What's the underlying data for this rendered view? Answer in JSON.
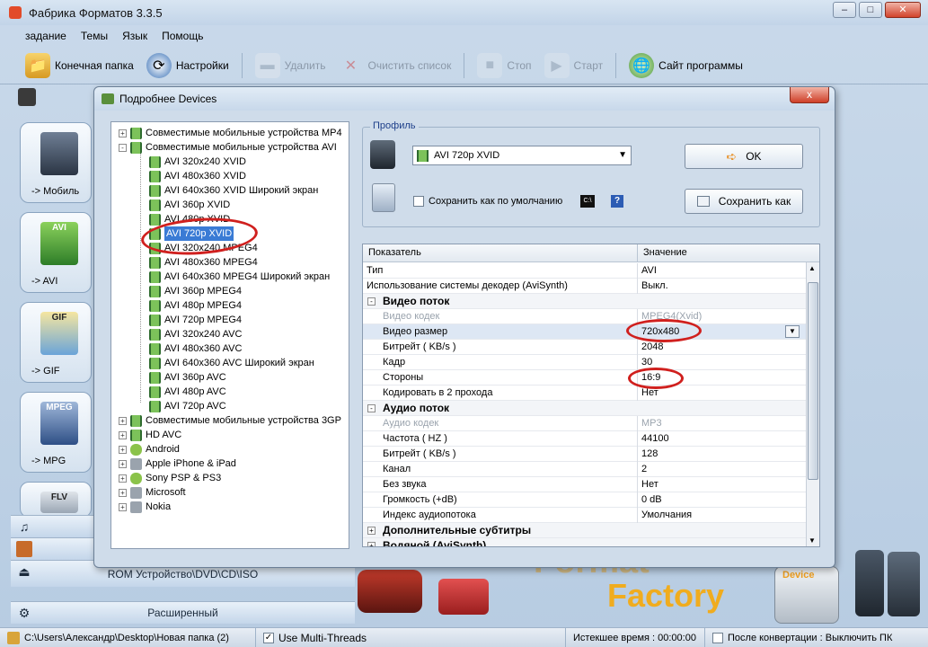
{
  "app": {
    "title": "Фабрика Форматов 3.3.5",
    "menu": [
      "задание",
      "Темы",
      "Язык",
      "Помощь"
    ],
    "toolbar": [
      {
        "label": "Конечная папка",
        "icon": "folder-icon",
        "enabled": true
      },
      {
        "label": "Настройки",
        "icon": "settings-icon",
        "enabled": true
      },
      {
        "label": "Удалить",
        "icon": "delete-icon",
        "enabled": false
      },
      {
        "label": "Очистить список",
        "icon": "clear-list-icon",
        "enabled": false
      },
      {
        "label": "Стоп",
        "icon": "stop-icon",
        "enabled": false
      },
      {
        "label": "Старт",
        "icon": "start-icon",
        "enabled": false
      },
      {
        "label": "Сайт программы",
        "icon": "globe-icon",
        "enabled": true
      }
    ],
    "left_buttons": [
      "-> Мобиль",
      "-> AVI",
      "-> GIF",
      "-> MPG"
    ],
    "left_thumbs": {
      "avi": "AVI",
      "gif": "GIF",
      "mpeg": "MPEG",
      "flv": "FLV"
    },
    "categories": [
      "ROM Устройство\\DVD\\CD\\ISO",
      "Расширенный"
    ],
    "brand": {
      "word1": "Format",
      "word2": "Factory",
      "device": "Device"
    },
    "status": {
      "path": "C:\\Users\\Александр\\Desktop\\Новая папка (2)",
      "multithreads": "Use Multi-Threads",
      "elapsed": "Истекшее время : 00:00:00",
      "after": "После конвертации : Выключить ПК"
    }
  },
  "dialog": {
    "title": "Подробнее Devices",
    "close": "x",
    "tree": [
      {
        "label": "Совместимые мобильные устройства MP4",
        "level": 0,
        "exp": "+",
        "icon": "film"
      },
      {
        "label": "Совместимые мобильные устройства AVI",
        "level": 0,
        "exp": "-",
        "icon": "film"
      },
      {
        "label": "AVI 320x240 XVID",
        "level": 1,
        "icon": "film"
      },
      {
        "label": "AVI 480x360 XVID",
        "level": 1,
        "icon": "film"
      },
      {
        "label": "AVI 640x360 XVID Широкий экран",
        "level": 1,
        "icon": "film"
      },
      {
        "label": "AVI 360p XVID",
        "level": 1,
        "icon": "film"
      },
      {
        "label": "AVI 480p XVID",
        "level": 1,
        "icon": "film"
      },
      {
        "label": "AVI 720p XVID",
        "level": 1,
        "icon": "film",
        "selected": true
      },
      {
        "label": "AVI 320x240 MPEG4",
        "level": 1,
        "icon": "film"
      },
      {
        "label": "AVI 480x360 MPEG4",
        "level": 1,
        "icon": "film"
      },
      {
        "label": "AVI 640x360 MPEG4 Широкий экран",
        "level": 1,
        "icon": "film"
      },
      {
        "label": "AVI 360p MPEG4",
        "level": 1,
        "icon": "film"
      },
      {
        "label": "AVI 480p MPEG4",
        "level": 1,
        "icon": "film"
      },
      {
        "label": "AVI 720p MPEG4",
        "level": 1,
        "icon": "film"
      },
      {
        "label": "AVI 320x240 AVC",
        "level": 1,
        "icon": "film"
      },
      {
        "label": "AVI 480x360 AVC",
        "level": 1,
        "icon": "film"
      },
      {
        "label": "AVI 640x360 AVC Широкий экран",
        "level": 1,
        "icon": "film"
      },
      {
        "label": "AVI 360p AVC",
        "level": 1,
        "icon": "film"
      },
      {
        "label": "AVI 480p AVC",
        "level": 1,
        "icon": "film"
      },
      {
        "label": "AVI 720p AVC",
        "level": 1,
        "icon": "film"
      },
      {
        "label": "Совместимые мобильные устройства 3GP",
        "level": 0,
        "exp": "+",
        "icon": "film"
      },
      {
        "label": "HD AVC",
        "level": 0,
        "exp": "+",
        "icon": "film"
      },
      {
        "label": "Android",
        "level": 0,
        "exp": "+",
        "icon": "green"
      },
      {
        "label": "Apple iPhone & iPad",
        "level": 0,
        "exp": "+",
        "icon": "gray"
      },
      {
        "label": "Sony PSP & PS3",
        "level": 0,
        "exp": "+",
        "icon": "green"
      },
      {
        "label": "Microsoft",
        "level": 0,
        "exp": "+",
        "icon": "gray"
      },
      {
        "label": "Nokia",
        "level": 0,
        "exp": "+",
        "icon": "gray"
      }
    ],
    "profile": {
      "legend": "Профиль",
      "selected": "AVI 720p XVID",
      "save_default": "Сохранить как по умолчанию",
      "help": "?",
      "cli": "C:\\",
      "ok": "OK",
      "save_as": "Сохранить как"
    },
    "props": {
      "col_key": "Показатель",
      "col_val": "Значение",
      "rows": [
        {
          "k": "Тип",
          "v": "AVI",
          "t": "row"
        },
        {
          "k": "Использование системы декодер (AviSynth)",
          "v": "Выкл.",
          "t": "row"
        },
        {
          "k": "Видео поток",
          "v": "",
          "t": "grp",
          "pm": "-"
        },
        {
          "k": "Видео кодек",
          "v": "MPEG4(Xvid)",
          "t": "dim",
          "indent": true
        },
        {
          "k": "Видео размер",
          "v": "720x480",
          "t": "sel",
          "indent": true,
          "dropdown": true
        },
        {
          "k": "Битрейт ( KB/s )",
          "v": "2048",
          "t": "row",
          "indent": true
        },
        {
          "k": "Кадр",
          "v": "30",
          "t": "row",
          "indent": true
        },
        {
          "k": "Стороны",
          "v": "16:9",
          "t": "row",
          "indent": true
        },
        {
          "k": "Кодировать в 2 прохода",
          "v": "Нет",
          "t": "row",
          "indent": true
        },
        {
          "k": "Аудио поток",
          "v": "",
          "t": "grp",
          "pm": "-"
        },
        {
          "k": "Аудио кодек",
          "v": "MP3",
          "t": "dim",
          "indent": true
        },
        {
          "k": "Частота ( HZ )",
          "v": "44100",
          "t": "row",
          "indent": true
        },
        {
          "k": "Битрейт ( KB/s )",
          "v": "128",
          "t": "row",
          "indent": true
        },
        {
          "k": "Канал",
          "v": "2",
          "t": "row",
          "indent": true
        },
        {
          "k": "Без звука",
          "v": "Нет",
          "t": "row",
          "indent": true
        },
        {
          "k": "Громкость (+dB)",
          "v": "0 dB",
          "t": "row",
          "indent": true
        },
        {
          "k": "Индекс аудиопотока",
          "v": "Умолчания",
          "t": "row",
          "indent": true
        },
        {
          "k": "Дополнительные субтитры",
          "v": "",
          "t": "grp",
          "pm": "+"
        },
        {
          "k": "Водяной (AviSynth)",
          "v": "",
          "t": "grp",
          "pm": "+"
        }
      ]
    }
  },
  "colors": {
    "accent": "#3a7bd5",
    "highlight": "#d0201e"
  }
}
